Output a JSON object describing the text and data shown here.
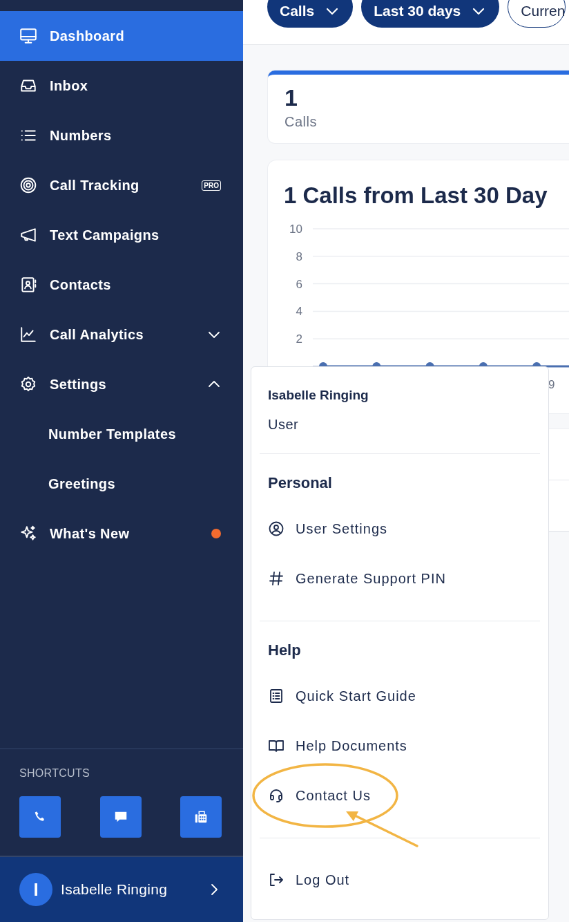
{
  "sidebar": {
    "items": [
      {
        "label": "Dashboard",
        "kind": "link",
        "selected": true,
        "unread": false
      },
      {
        "label": "Inbox",
        "kind": "link",
        "selected": false,
        "unread": false
      },
      {
        "label": "Numbers",
        "kind": "link",
        "selected": false,
        "unread": false
      },
      {
        "label": "Call Tracking",
        "kind": "link",
        "selected": false,
        "unread": false,
        "badge": "PRO"
      },
      {
        "label": "Text Campaigns",
        "kind": "link",
        "selected": false,
        "unread": false
      },
      {
        "label": "Contacts",
        "kind": "link",
        "selected": false,
        "unread": false
      },
      {
        "label": "Call Analytics",
        "kind": "group",
        "selected": false,
        "unread": false,
        "expanded": false
      },
      {
        "label": "Settings",
        "kind": "group",
        "selected": false,
        "unread": false,
        "expanded": true,
        "children": [
          {
            "label": "Number Templates",
            "selected": false
          },
          {
            "label": "Greetings",
            "selected": false
          }
        ]
      },
      {
        "label": "What's New",
        "kind": "link",
        "selected": false,
        "unread": true
      }
    ],
    "shortcuts": {
      "title": "SHORTCUTS"
    },
    "user": {
      "initial": "I",
      "name": "Isabelle Ringing"
    }
  },
  "filters": [
    {
      "label": "Calls",
      "kind": "dropdown"
    },
    {
      "label": "Last 30 days",
      "kind": "dropdown"
    },
    {
      "label": "Curren",
      "kind": "outline"
    }
  ],
  "stat": {
    "value": "1",
    "label": "Calls"
  },
  "chart": {
    "title": "1 Calls from Last 30 Day",
    "axis_fragment": "9",
    "chart_data": {
      "type": "line",
      "grid": true,
      "ylim": [
        0,
        10
      ],
      "yticks": [
        2,
        4,
        6,
        8,
        10
      ],
      "series": [
        {
          "color": "#4a6fb0",
          "marker": "circle",
          "values": [
            0,
            0,
            0,
            0,
            0,
            0
          ]
        }
      ]
    }
  },
  "user_menu": {
    "name": "Isabelle Ringing",
    "role": "User",
    "sections": [
      {
        "title": "Personal",
        "items": [
          {
            "label": "User Settings",
            "highlighted": false
          },
          {
            "label": "Generate Support PIN",
            "highlighted": false
          }
        ]
      },
      {
        "title": "Help",
        "items": [
          {
            "label": "Quick Start Guide",
            "highlighted": false
          },
          {
            "label": "Help Documents",
            "highlighted": false
          },
          {
            "label": "Contact Us",
            "highlighted": true
          }
        ]
      }
    ],
    "logout": "Log Out"
  }
}
